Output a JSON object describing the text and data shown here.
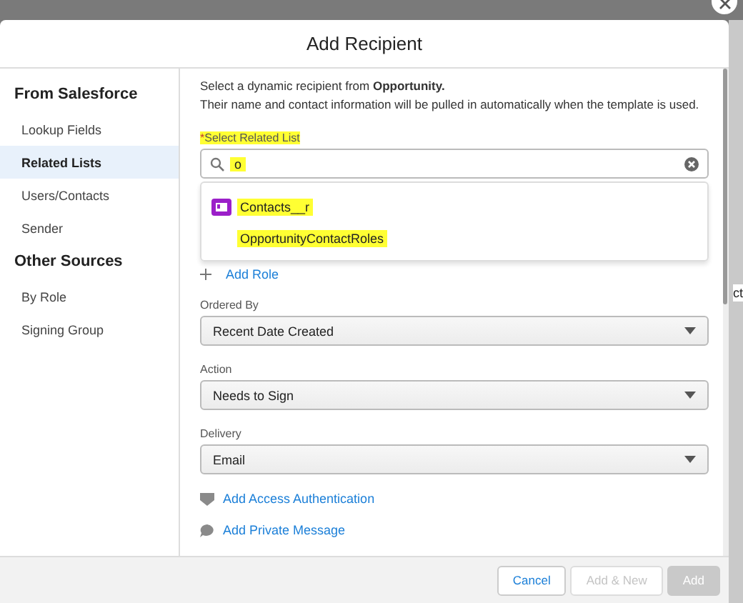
{
  "dialog": {
    "title": "Add Recipient"
  },
  "sidebar": {
    "sections": [
      {
        "heading": "From Salesforce",
        "items": [
          {
            "label": "Lookup Fields",
            "selected": false
          },
          {
            "label": "Related Lists",
            "selected": true
          },
          {
            "label": "Users/Contacts",
            "selected": false
          },
          {
            "label": "Sender",
            "selected": false
          }
        ]
      },
      {
        "heading": "Other Sources",
        "items": [
          {
            "label": "By Role",
            "selected": false
          },
          {
            "label": "Signing Group",
            "selected": false
          }
        ]
      }
    ]
  },
  "intro": {
    "text": "Select a dynamic recipient from  **Opportunity.**",
    "text2": "Their name and contact information will be pulled in automatically when the template is used."
  },
  "related_list": {
    "label": "Select Related List",
    "required_mark": "*",
    "highlighted": true,
    "value": "o",
    "value_highlighted": true,
    "options": [
      {
        "label": "Contacts__r",
        "kind": "icon",
        "highlighted": true
      },
      {
        "label": "OpportunityContactRoles",
        "kind": "plain",
        "highlighted": true
      }
    ]
  },
  "add_role": "Add Role",
  "selects": [
    {
      "label": "Ordered By",
      "value": "Recent Date Created"
    },
    {
      "label": "Action",
      "value": "Needs to Sign"
    },
    {
      "label": "Delivery",
      "value": "Email"
    }
  ],
  "links": [
    {
      "label": "Add Access Authentication",
      "kind": "shield"
    },
    {
      "label": "Add Private Message",
      "kind": "bubble"
    }
  ],
  "footer": {
    "buttons": [
      {
        "label": "Cancel",
        "disabled": false
      },
      {
        "label": "Add & New",
        "disabled": true
      },
      {
        "label": "Add",
        "disabled": true,
        "kind": "primary"
      }
    ]
  },
  "background_fragment": "ct"
}
